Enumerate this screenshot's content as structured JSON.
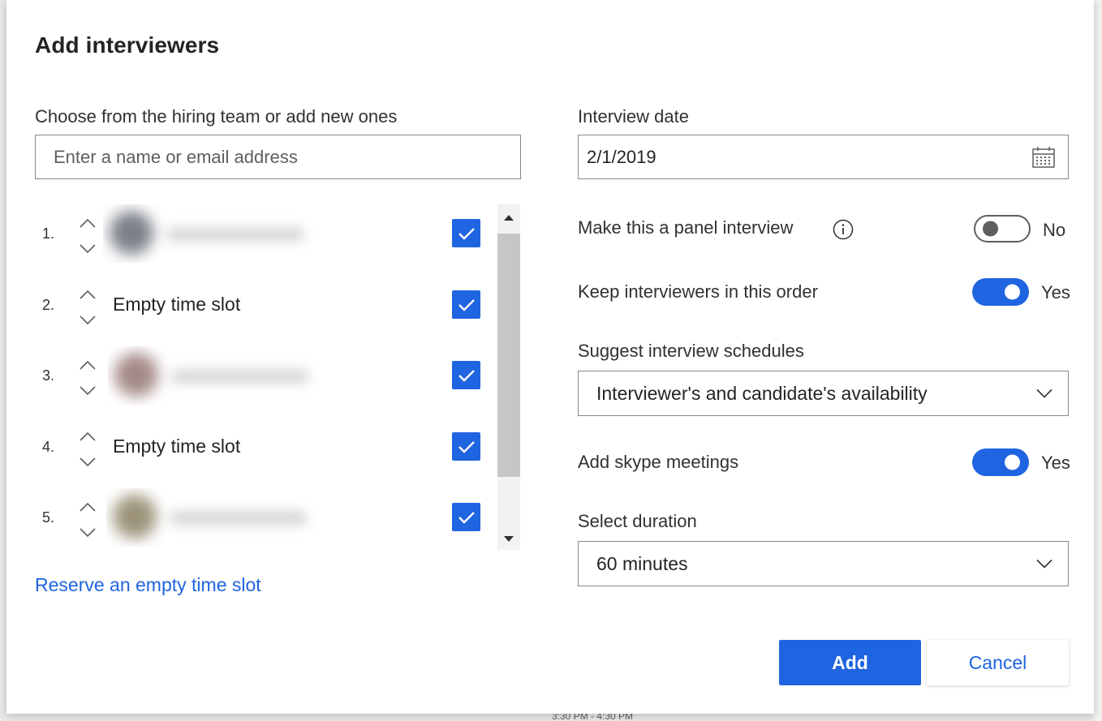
{
  "dialog": {
    "title": "Add interviewers"
  },
  "interviewers": {
    "label": "Choose from the hiring team or add new ones",
    "search_placeholder": "Enter a name or email address",
    "rows": [
      {
        "number": "1.",
        "type": "person",
        "text": "",
        "checked": true,
        "avatar_color": "#7b8088"
      },
      {
        "number": "2.",
        "type": "empty",
        "text": "Empty time slot",
        "checked": true
      },
      {
        "number": "3.",
        "type": "person",
        "text": "",
        "checked": true,
        "avatar_color": "#a48a86"
      },
      {
        "number": "4.",
        "type": "empty",
        "text": "Empty time slot",
        "checked": true
      },
      {
        "number": "5.",
        "type": "person",
        "text": "",
        "checked": true,
        "avatar_color": "#9c937a"
      }
    ],
    "reserve_link": "Reserve an empty time slot"
  },
  "settings": {
    "interview_date_label": "Interview date",
    "interview_date_value": "2/1/2019",
    "panel_interview_label": "Make this a panel interview",
    "panel_interview_state": "No",
    "keep_order_label": "Keep interviewers in this order",
    "keep_order_state": "Yes",
    "suggest_label": "Suggest interview schedules",
    "suggest_value": "Interviewer's and candidate's availability",
    "skype_label": "Add skype meetings",
    "skype_state": "Yes",
    "duration_label": "Select duration",
    "duration_value": "60 minutes"
  },
  "actions": {
    "add_label": "Add",
    "cancel_label": "Cancel"
  },
  "background": {
    "footer_text": "3:30 PM - 4:30 PM"
  },
  "colors": {
    "accent": "#1f64e0",
    "text": "#252423",
    "border": "#8a8886"
  }
}
